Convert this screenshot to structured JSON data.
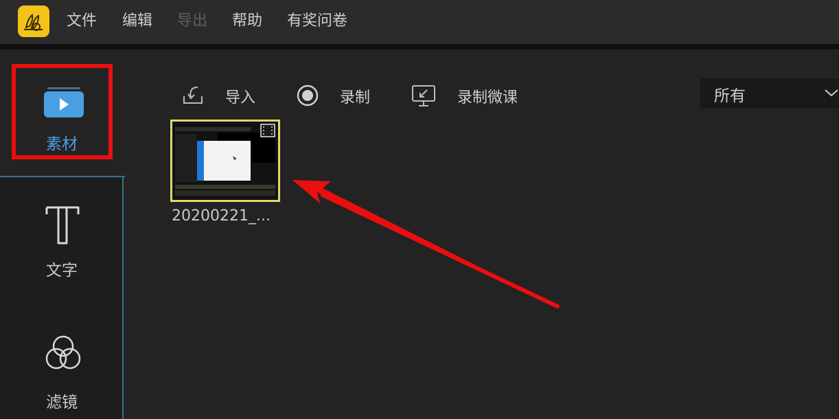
{
  "menu": {
    "items": [
      {
        "label": "文件",
        "disabled": false
      },
      {
        "label": "编辑",
        "disabled": false
      },
      {
        "label": "导出",
        "disabled": true
      },
      {
        "label": "帮助",
        "disabled": false
      },
      {
        "label": "有奖问卷",
        "disabled": false
      }
    ]
  },
  "sidebar": {
    "tabs": [
      {
        "label": "素材",
        "icon": "media-play-icon",
        "active": true
      },
      {
        "label": "文字",
        "icon": "text-t-icon",
        "active": false
      },
      {
        "label": "滤镜",
        "icon": "filter-circles-icon",
        "active": false
      }
    ]
  },
  "toolbar": {
    "import_label": "导入",
    "record_label": "录制",
    "record_lesson_label": "录制微课"
  },
  "filter": {
    "selected": "所有"
  },
  "media": {
    "items": [
      {
        "name": "20200221_..."
      }
    ]
  },
  "colors": {
    "accent": "#4a9fe0",
    "highlight_box": "#e90f0f",
    "selection_border": "#ddd86a",
    "logo_bg": "#f2c318"
  }
}
